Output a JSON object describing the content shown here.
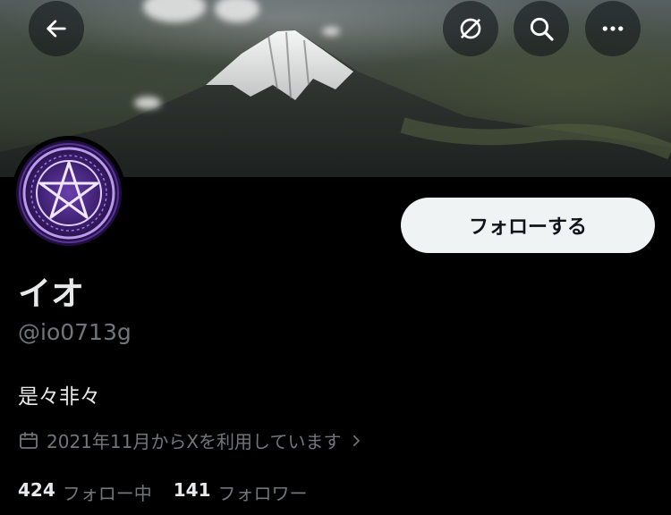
{
  "header": {
    "back_icon": "arrow-left-icon",
    "actions": [
      "no-sync-icon",
      "search-icon",
      "more-icon"
    ]
  },
  "profile": {
    "display_name": "イオ",
    "handle": "@io0713g",
    "bio": "是々非々",
    "joined": "2021年11月からXを利用しています",
    "follow_button": "フォローする",
    "following_count": "424",
    "following_label": "フォロー中",
    "followers_count": "141",
    "followers_label": "フォロワー"
  },
  "colors": {
    "background": "#000000",
    "primary_text": "#e7e9ea",
    "secondary_text": "#71767b",
    "button_bg": "#eff3f4",
    "avatar_accent": "#9b6ef3"
  }
}
